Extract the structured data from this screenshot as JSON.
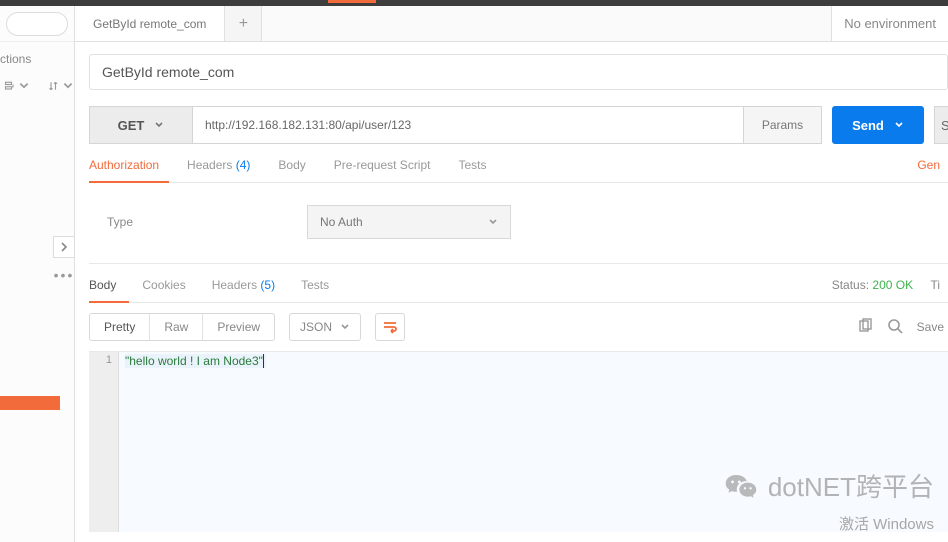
{
  "sidebar": {
    "collections_label": "ctions"
  },
  "tabs": {
    "items": [
      {
        "label": "GetById remote_com"
      }
    ],
    "environment": "No environment"
  },
  "request": {
    "title": "GetById remote_com",
    "method": "GET",
    "url": "http://192.168.182.131:80/api/user/123",
    "params_label": "Params",
    "send_label": "Send",
    "save_stub": "S"
  },
  "req_tabs": {
    "authorization": "Authorization",
    "headers": "Headers",
    "headers_count": "(4)",
    "body": "Body",
    "prerequest": "Pre-request Script",
    "tests": "Tests",
    "generate": "Gen"
  },
  "auth": {
    "type_label": "Type",
    "selected": "No Auth"
  },
  "resp_tabs": {
    "body": "Body",
    "cookies": "Cookies",
    "headers": "Headers",
    "headers_count": "(5)",
    "tests": "Tests",
    "status_label": "Status:",
    "status_value": "200 OK",
    "time_stub": "Ti"
  },
  "body_toolbar": {
    "pretty": "Pretty",
    "raw": "Raw",
    "preview": "Preview",
    "format": "JSON",
    "save_stub": "Save"
  },
  "response_body": {
    "line_no": "1",
    "content": "\"hello world ! I am Node3\""
  },
  "watermark": {
    "text": "dotNET跨平台",
    "activate": "激活 Windows"
  }
}
